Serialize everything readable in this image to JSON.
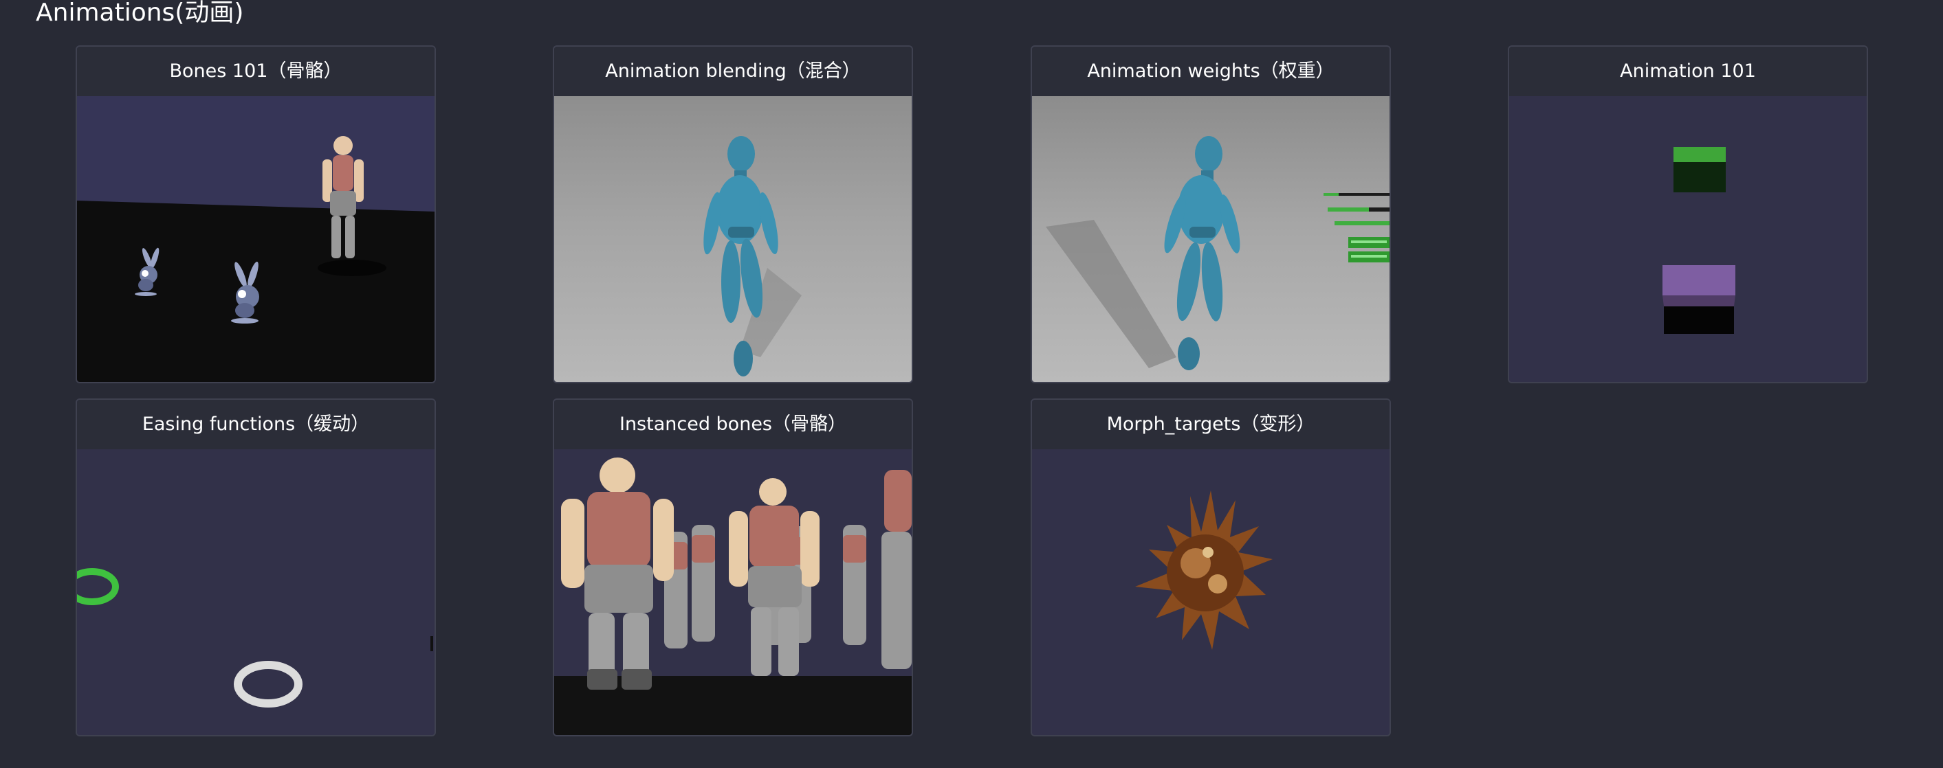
{
  "section": {
    "title": "Animations(动画)"
  },
  "cards": [
    {
      "title": "Bones 101（骨骼）"
    },
    {
      "title": "Animation blending（混合）"
    },
    {
      "title": "Animation weights（权重）"
    },
    {
      "title": "Animation 101"
    },
    {
      "title": "Easing functions（缓动）"
    },
    {
      "title": "Instanced bones（骨骼）"
    },
    {
      "title": "Morph_targets（变形）"
    }
  ],
  "colors": {
    "page_background": "#282a35",
    "card_header": "#2b2d38",
    "card_background": "#323449",
    "card_border": "#3f4150",
    "text": "#ffffff"
  }
}
